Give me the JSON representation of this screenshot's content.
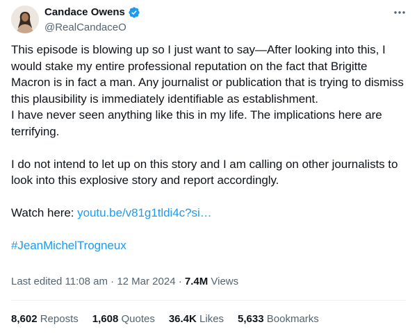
{
  "author": {
    "name": "Candace Owens",
    "handle": "@RealCandaceO",
    "verified_color": "#1d9bf0"
  },
  "menu": {
    "icon": "more-dots-icon"
  },
  "tweet": {
    "paragraph1": "This episode is blowing up so I just want to say—After looking into this, I would stake my entire professional reputation on the fact that Brigitte Macron is in fact a man. Any journalist or publication that is trying to dismiss this plausibility is immediately identifiable as establishment.",
    "paragraph1b": "I have never seen anything like this in my life. The implications here are terrifying.",
    "paragraph2": "I do not intend to let up on this story and I am calling on other journalists to look into this explosive story and report accordingly.",
    "watch_label": "Watch here: ",
    "link": "youtu.be/v81g1tldi4c?si…",
    "hashtag": "#JeanMichelTrogneux"
  },
  "meta": {
    "edited": "Last edited 11:08 am · 12 Mar 2024 · ",
    "views_count": "7.4M",
    "views_label": " Views"
  },
  "stats": [
    {
      "count": "8,602",
      "label": " Reposts"
    },
    {
      "count": "1,608",
      "label": " Quotes"
    },
    {
      "count": "36.4K",
      "label": " Likes"
    },
    {
      "count": "5,633",
      "label": " Bookmarks"
    }
  ],
  "colors": {
    "link": "#1d9bf0",
    "secondary": "#536471",
    "text": "#0f1419"
  }
}
